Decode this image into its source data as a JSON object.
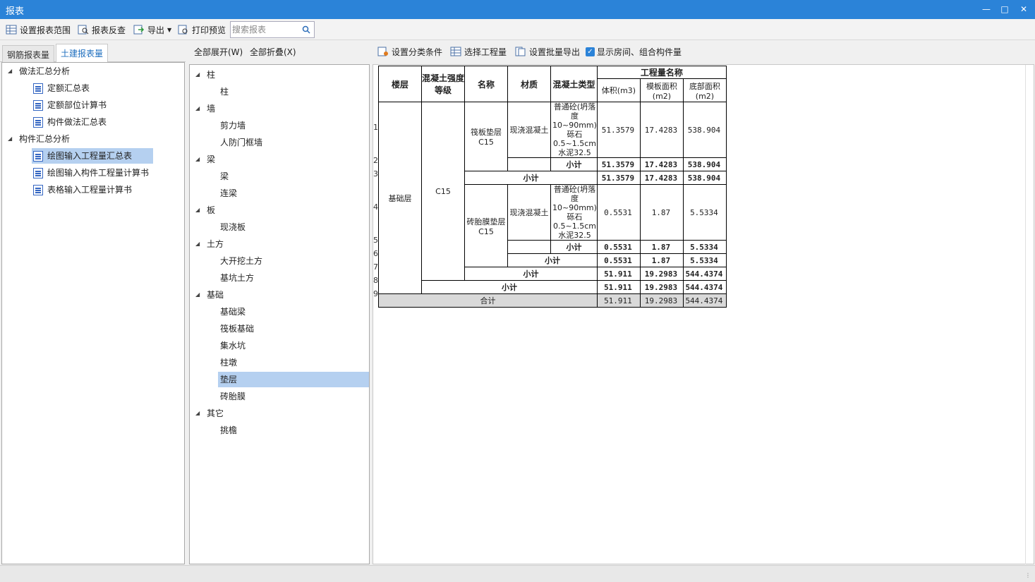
{
  "window": {
    "title": "报表"
  },
  "toolbar": {
    "set_range": "设置报表范围",
    "reverse_check": "报表反查",
    "export": "导出",
    "print_preview": "打印预览",
    "search_placeholder": "搜索报表"
  },
  "left": {
    "tabs": [
      "钢筋报表量",
      "土建报表量"
    ],
    "groups": [
      {
        "label": "做法汇总分析",
        "items": [
          "定额汇总表",
          "定额部位计算书",
          "构件做法汇总表"
        ]
      },
      {
        "label": "构件汇总分析",
        "items": [
          "绘图输入工程量汇总表",
          "绘图输入构件工程量计算书",
          "表格输入工程量计算书"
        ]
      }
    ]
  },
  "middle": {
    "expand_all": "全部展开(W)",
    "collapse_all": "全部折叠(X)",
    "groups": [
      {
        "label": "柱",
        "items": [
          "柱"
        ]
      },
      {
        "label": "墙",
        "items": [
          "剪力墙",
          "人防门框墙"
        ]
      },
      {
        "label": "梁",
        "items": [
          "梁",
          "连梁"
        ]
      },
      {
        "label": "板",
        "items": [
          "现浇板"
        ]
      },
      {
        "label": "土方",
        "items": [
          "大开挖土方",
          "基坑土方"
        ]
      },
      {
        "label": "基础",
        "items": [
          "基础梁",
          "筏板基础",
          "集水坑",
          "柱墩",
          "垫层",
          "砖胎膜"
        ]
      },
      {
        "label": "其它",
        "items": [
          "挑檐"
        ]
      }
    ]
  },
  "right": {
    "set_category": "设置分类条件",
    "select_quantity": "选择工程量",
    "batch_export": "设置批量导出",
    "show_rooms": "显示房间、组合构件量"
  },
  "report": {
    "headers": {
      "floor": "楼层",
      "grade": "混凝土强度等级",
      "name": "名称",
      "material": "材质",
      "type": "混凝土类型",
      "quantity_group": "工程量名称",
      "volume": "体积(m3)",
      "formwork": "模板面积(m2)",
      "bottom": "底部面积(m2)"
    },
    "row_numbers": [
      "1",
      "2",
      "3",
      "4",
      "5",
      "6",
      "7",
      "8",
      "9"
    ],
    "floor": "基础层",
    "grade": "C15",
    "material": "现浇混凝土",
    "concrete_type": "普通砼(坍落度10~90mm) 砾石0.5~1.5cm 水泥32.5",
    "subtotal_label": "小计",
    "total_label": "合计",
    "item1": {
      "name": "筏板垫层C15",
      "volume": "51.3579",
      "formwork": "17.4283",
      "bottom": "538.904"
    },
    "item2": {
      "name": "砖胎膜垫层C15",
      "volume": "0.5531",
      "formwork": "1.87",
      "bottom": "5.5334"
    },
    "grade_sub": {
      "volume": "51.911",
      "formwork": "19.2983",
      "bottom": "544.4374"
    },
    "total": {
      "volume": "51.911",
      "formwork": "19.2983",
      "bottom": "544.4374"
    }
  }
}
